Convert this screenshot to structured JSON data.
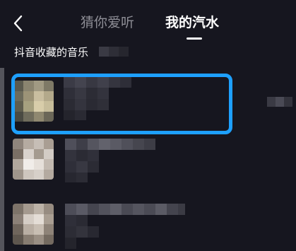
{
  "header": {
    "tabs": [
      {
        "label": "猜你爱听",
        "active": false
      },
      {
        "label": "我的汽水",
        "active": true
      }
    ]
  },
  "section": {
    "title": "抖音收藏的音乐"
  },
  "colors": {
    "background": "#16161f",
    "highlight": "#1ea0ff",
    "active_tab": "#ffffff",
    "inactive_tab": "#8e8e96"
  },
  "icons": {
    "back": "chevron-left-icon"
  }
}
